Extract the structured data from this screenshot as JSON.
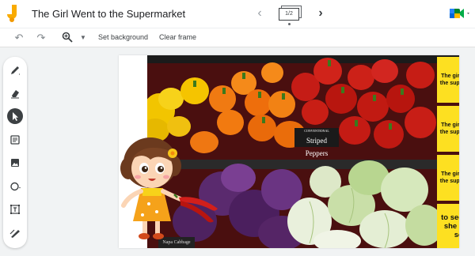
{
  "app": {
    "title": "The Girl Went to the Supermarket",
    "frame_indicator": "1/2"
  },
  "toolbar": {
    "set_background": "Set background",
    "clear_frame": "Clear frame"
  },
  "sidebar": {
    "tools": [
      "pen",
      "eraser",
      "select",
      "sticky-note",
      "image",
      "circle",
      "text-box",
      "laser"
    ],
    "active_tool": "select"
  },
  "canvas": {
    "sticky_notes": [
      {
        "text": "The girl went to the supermarket"
      },
      {
        "text": "The girl went to the supermarket"
      },
      {
        "text": "The girl went to the supermarket"
      },
      {
        "text": "to see what she could see."
      }
    ],
    "photo_signs": {
      "striped_peppers": "Striped Peppers",
      "conventional": "CONVENTIONAL",
      "napa_cabbage": "Napa Cabbage"
    }
  },
  "colors": {
    "sticky_note": "#fde021",
    "active_tool_bg": "#3c4043",
    "logo": "#f9ab00"
  }
}
